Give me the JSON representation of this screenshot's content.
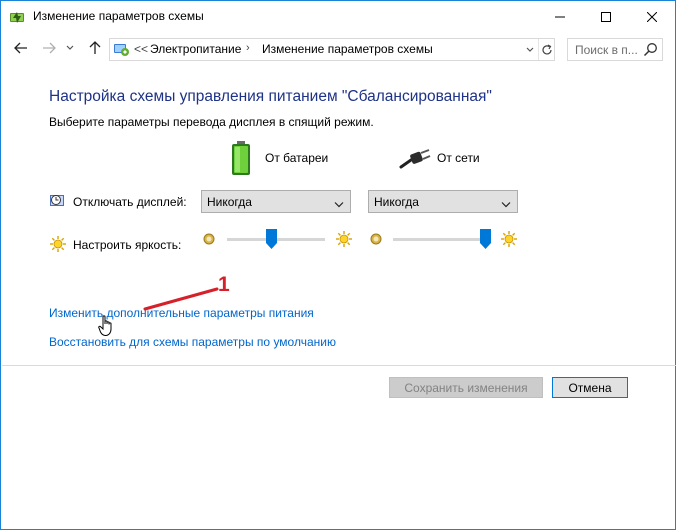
{
  "window": {
    "title": "Изменение параметров схемы"
  },
  "address": {
    "prefix": "<<",
    "crumbs": [
      "Электропитание",
      "Изменение параметров схемы"
    ]
  },
  "search": {
    "placeholder": "Поиск в п..."
  },
  "content": {
    "heading": "Настройка схемы управления питанием \"Сбалансированная\"",
    "subtitle": "Выберите параметры перевода дисплея в спящий режим.",
    "columns": {
      "battery": "От батареи",
      "ac": "От сети"
    },
    "display_off": {
      "label": "Отключать дисплей:",
      "battery_value": "Никогда",
      "ac_value": "Никогда"
    },
    "brightness": {
      "label": "Настроить яркость:",
      "battery_level": 0.45,
      "ac_level": 1.0
    },
    "links": {
      "advanced": "Изменить дополнительные параметры питания",
      "restore": "Восстановить для схемы параметры по умолчанию"
    },
    "annotation_number": "1"
  },
  "buttons": {
    "save": "Сохранить изменения",
    "cancel": "Отмена"
  },
  "colors": {
    "heading": "#1e3287",
    "link": "#0066cc",
    "accent": "#0078d7",
    "annotation": "#d6202a"
  }
}
